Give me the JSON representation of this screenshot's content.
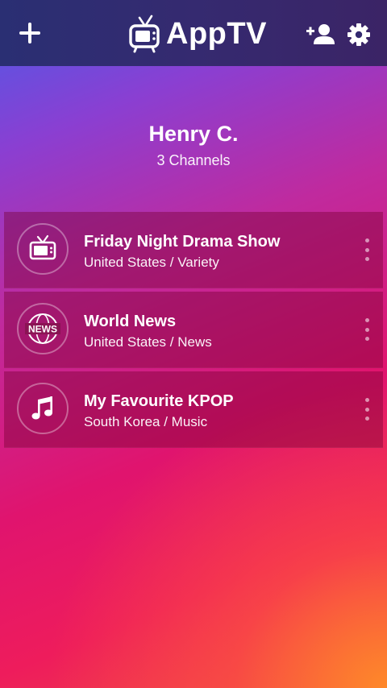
{
  "app": {
    "title": "AppTV",
    "icons": {
      "add": "plus-icon",
      "logo": "tv-icon",
      "add_user": "add-user-icon",
      "settings": "gear-icon"
    }
  },
  "profile": {
    "name": "Henry C.",
    "channels_label": "3 Channels"
  },
  "channels": [
    {
      "title": "Friday Night Drama Show",
      "subtitle": "United States / Variety",
      "icon": "tv-icon"
    },
    {
      "title": "World News",
      "subtitle": "United States / News",
      "icon": "news-globe-icon",
      "icon_text": "NEWS"
    },
    {
      "title": "My Favourite KPOP",
      "subtitle": "South Korea / Music",
      "icon": "music-note-icon"
    }
  ],
  "colors": {
    "topbar": "#2f2b72",
    "gradient_start": "#4b5be8",
    "gradient_mid": "#e0146e",
    "gradient_end": "#ff8c28"
  }
}
